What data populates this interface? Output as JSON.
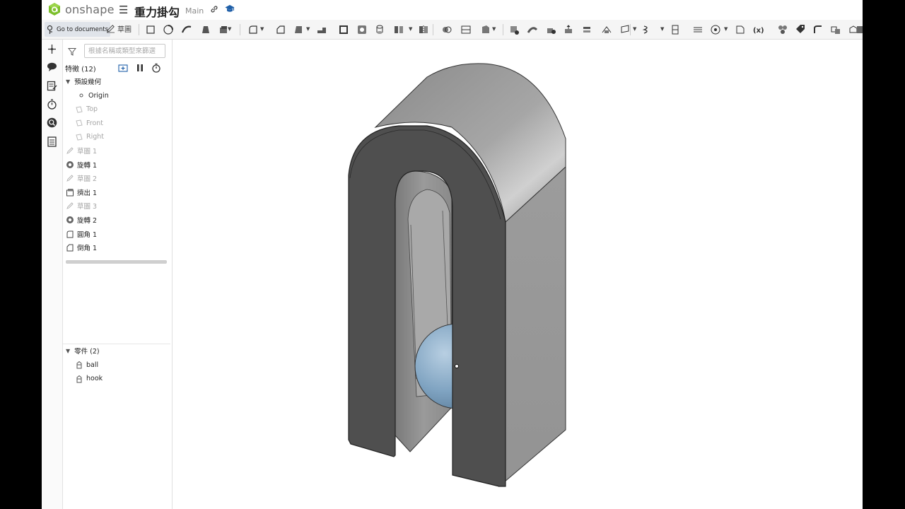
{
  "app": {
    "brand": "onshape",
    "document_title": "重力掛勾",
    "workspace": "Main"
  },
  "toolbar": {
    "documents_tooltip": "Go to documents",
    "sketch_label": "草圖",
    "icons": [
      "part-studio-icon",
      "revolve-icon",
      "sweep-icon",
      "loft-icon",
      "thicken-icon",
      "fillet-icon",
      "chamfer-icon",
      "draft-icon",
      "rib-icon",
      "shell-icon",
      "hole-icon",
      "thread-icon",
      "linear-pattern-icon",
      "mirror-icon",
      "boolean-icon",
      "split-icon",
      "transform-icon",
      "delete-part-icon",
      "modify-fillet-icon",
      "delete-face-icon",
      "move-face-icon",
      "replace-face-icon",
      "offset-surface-icon",
      "plane-icon",
      "helix-icon",
      "mate-connector-icon",
      "measure-icon",
      "variable-icon",
      "feature-pattern-icon",
      "tag-icon",
      "sheet-metal-icon",
      "flange-icon",
      "corner-icon",
      "bend-relief-icon",
      "tab-icon",
      "unfold-icon"
    ]
  },
  "panel": {
    "search_placeholder": "根據名稱或類型來篩選",
    "features_header": "特徵 (12)",
    "default_geometry_label": "預設幾何",
    "default_geometry_items": [
      "Origin",
      "Top",
      "Front",
      "Right"
    ],
    "features": [
      {
        "label": "草圖 1",
        "type": "sketch",
        "dim": true
      },
      {
        "label": "旋轉 1",
        "type": "revolve",
        "dim": false
      },
      {
        "label": "草圖 2",
        "type": "sketch",
        "dim": true
      },
      {
        "label": "擠出 1",
        "type": "extrude",
        "dim": false
      },
      {
        "label": "草圖 3",
        "type": "sketch",
        "dim": true
      },
      {
        "label": "旋轉 2",
        "type": "revolve",
        "dim": false
      },
      {
        "label": "圓角 1",
        "type": "fillet",
        "dim": false
      },
      {
        "label": "倒角 1",
        "type": "chamfer",
        "dim": false
      }
    ],
    "parts_header": "零件 (2)",
    "parts": [
      "ball",
      "hook"
    ]
  },
  "colors": {
    "brand_green": "#7cbf2c",
    "hook_face_dark": "#4f4f4f",
    "hook_face_light": "#9a9a9a",
    "ball": "#7fa3c1",
    "accent_blue": "#1f5fa8"
  }
}
